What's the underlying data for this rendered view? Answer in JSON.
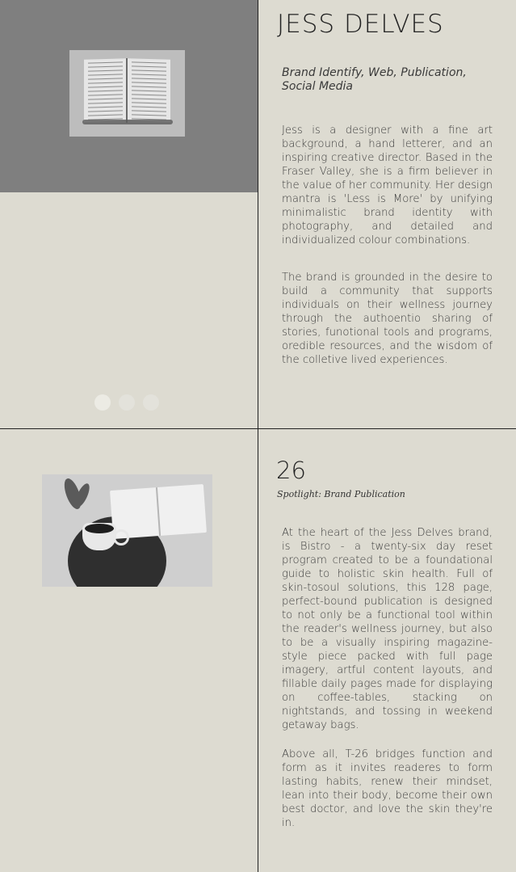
{
  "project": {
    "title": "JESS DELVES",
    "subtitle": "Brand Identify, Web, Publication, Social Media",
    "paragraphs": [
      "Jess is a designer with a fine art background, a hand letterer, and an inspiring creative director. Based in the Fraser Valley, she is a firm believer in the value of her community. Her design mantra is 'Less is More' by unifying minimalistic brand identity with photography, and detailed and individualized colour combinations.",
      "The brand is grounded in the desire to build a community that supports individuals on their wellness journey through the authoentio sharing of stories, funotional tools and programs, oredible resources, and the wisdom of the colletive lived experiences."
    ],
    "image_alt": "open-book-photo"
  },
  "carousel": {
    "slide_count": 3,
    "active_index": 0
  },
  "spotlight": {
    "number": "26",
    "label": "Spotlight: Brand Publication",
    "paragraphs": [
      "At the heart of the Jess Delves brand, is Bistro - a twenty-six day reset program created to be a foundational guide to holistic skin health. Full of skin-tosoul solutions, this 128 page, perfect-bound publication is designed to not only be a functional tool within the reader's wellness journey, but also to be a visually inspiring magazine-style piece packed with full page imagery, artful content layouts, and fillable daily pages made for displaying on coffee-tables, stacking on nightstands, and tossing in weekend getaway bags.",
      "Above all, T-26 bridges function and form as it invites readeres to form lasting habits, renew their mindset, lean into their body, become their own best doctor, and love the skin they're in."
    ],
    "image_alt": "coffee-and-book-photo"
  },
  "colors": {
    "background": "#dddbd1",
    "panel_gray": "#7f7f7f",
    "divider": "#222222"
  }
}
